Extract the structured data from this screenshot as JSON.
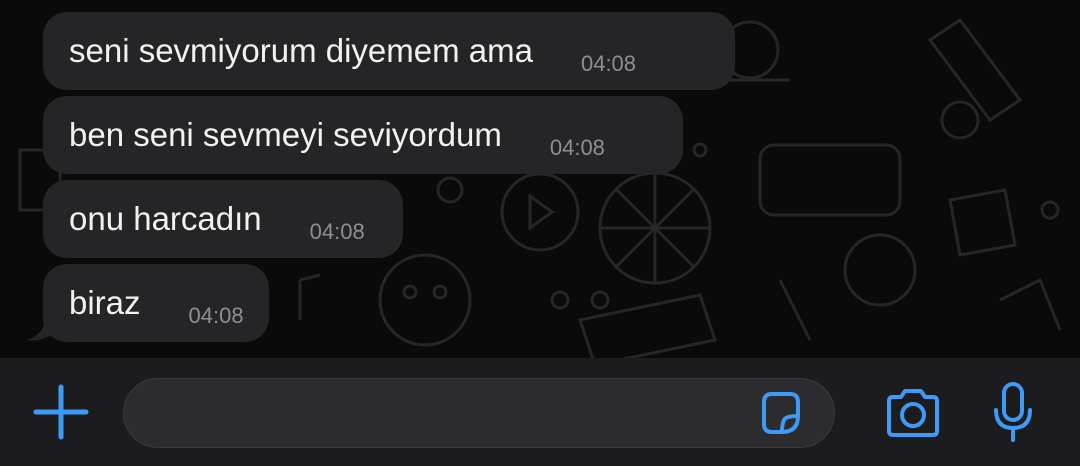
{
  "messages": [
    {
      "text": "seni sevmiyorum diyemem ama",
      "time": "04:08"
    },
    {
      "text": "ben seni sevmeyi seviyordum",
      "time": "04:08"
    },
    {
      "text": "onu harcadın",
      "time": "04:08"
    },
    {
      "text": "biraz",
      "time": "04:08"
    }
  ],
  "composer": {
    "value": "",
    "icons": [
      "plus-icon",
      "sticker-icon",
      "camera-icon",
      "microphone-icon"
    ]
  },
  "colors": {
    "accent": "#3d9bf5",
    "bubble": "#252527",
    "background": "#0a0a0a",
    "input_bar": "#1c1c1e"
  }
}
